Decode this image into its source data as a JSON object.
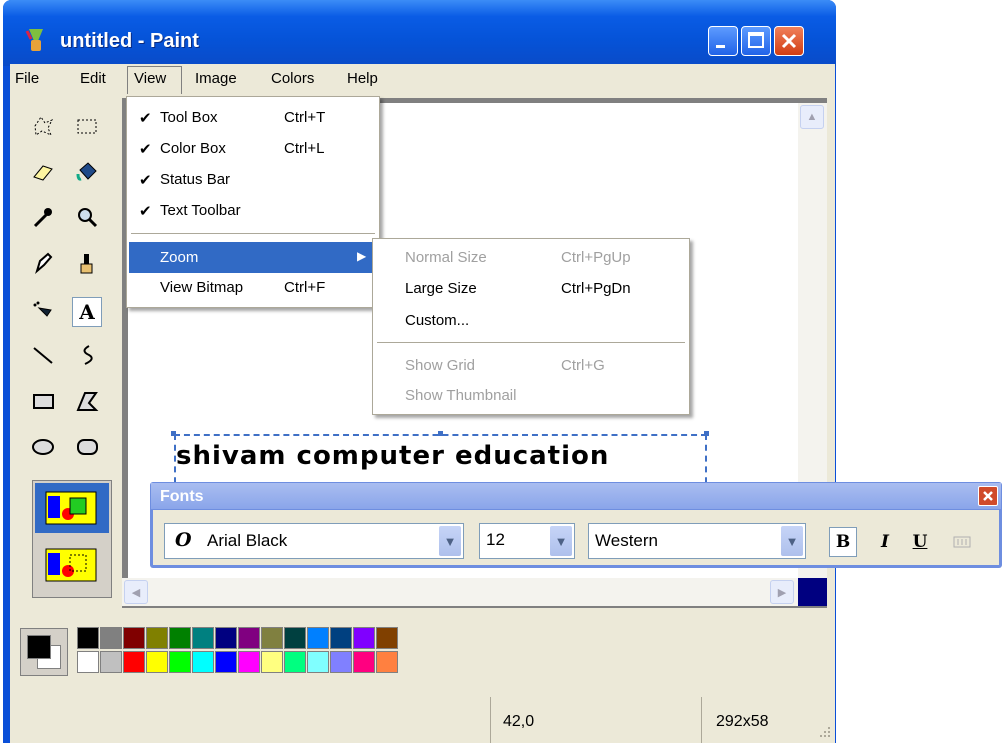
{
  "window": {
    "title": "untitled - Paint"
  },
  "menubar": {
    "items": [
      "File",
      "Edit",
      "View",
      "Image",
      "Colors",
      "Help"
    ]
  },
  "view_menu": {
    "items": [
      {
        "label": "Tool Box",
        "shortcut": "Ctrl+T",
        "checked": true
      },
      {
        "label": "Color Box",
        "shortcut": "Ctrl+L",
        "checked": true
      },
      {
        "label": "Status Bar",
        "shortcut": "",
        "checked": true
      },
      {
        "label": "Text Toolbar",
        "shortcut": "",
        "checked": true
      },
      {
        "label": "Zoom",
        "shortcut": "",
        "checked": false,
        "submenu": true
      },
      {
        "label": "View Bitmap",
        "shortcut": "Ctrl+F",
        "checked": false
      }
    ]
  },
  "zoom_submenu": {
    "items": [
      {
        "label": "Normal Size",
        "shortcut": "Ctrl+PgUp",
        "enabled": false
      },
      {
        "label": "Large Size",
        "shortcut": "Ctrl+PgDn",
        "enabled": true
      },
      {
        "label": "Custom...",
        "shortcut": "",
        "enabled": true
      },
      {
        "label": "Show Grid",
        "shortcut": "Ctrl+G",
        "enabled": false
      },
      {
        "label": "Show Thumbnail",
        "shortcut": "",
        "enabled": false
      }
    ]
  },
  "canvas": {
    "text": "shivam computer education"
  },
  "fonts_toolbar": {
    "title": "Fonts",
    "font_name": "Arial Black",
    "font_size": "12",
    "script": "Western",
    "bold_label": "B",
    "italic_label": "I",
    "underline_label": "U",
    "active": "bold"
  },
  "palette": {
    "top": [
      "#000000",
      "#808080",
      "#800000",
      "#808000",
      "#008000",
      "#008080",
      "#000080",
      "#800080",
      "#808040",
      "#004040",
      "#0080ff",
      "#004080",
      "#8000ff",
      "#804000"
    ],
    "bottom": [
      "#ffffff",
      "#c0c0c0",
      "#ff0000",
      "#ffff00",
      "#00ff00",
      "#00ffff",
      "#0000ff",
      "#ff00ff",
      "#ffff80",
      "#00ff80",
      "#80ffff",
      "#8080ff",
      "#ff0080",
      "#ff8040"
    ],
    "foreground": "#000000",
    "background": "#ffffff"
  },
  "statusbar": {
    "coords": "42,0",
    "size": "292x58"
  },
  "icons": [
    "app-icon",
    "free-select-icon",
    "rect-select-icon",
    "eraser-icon",
    "fill-icon",
    "eyedropper-icon",
    "magnifier-icon",
    "pencil-icon",
    "brush-icon",
    "airbrush-icon",
    "text-icon",
    "line-icon",
    "curve-icon",
    "rectangle-icon",
    "polygon-icon",
    "ellipse-icon",
    "rounded-rect-icon"
  ]
}
